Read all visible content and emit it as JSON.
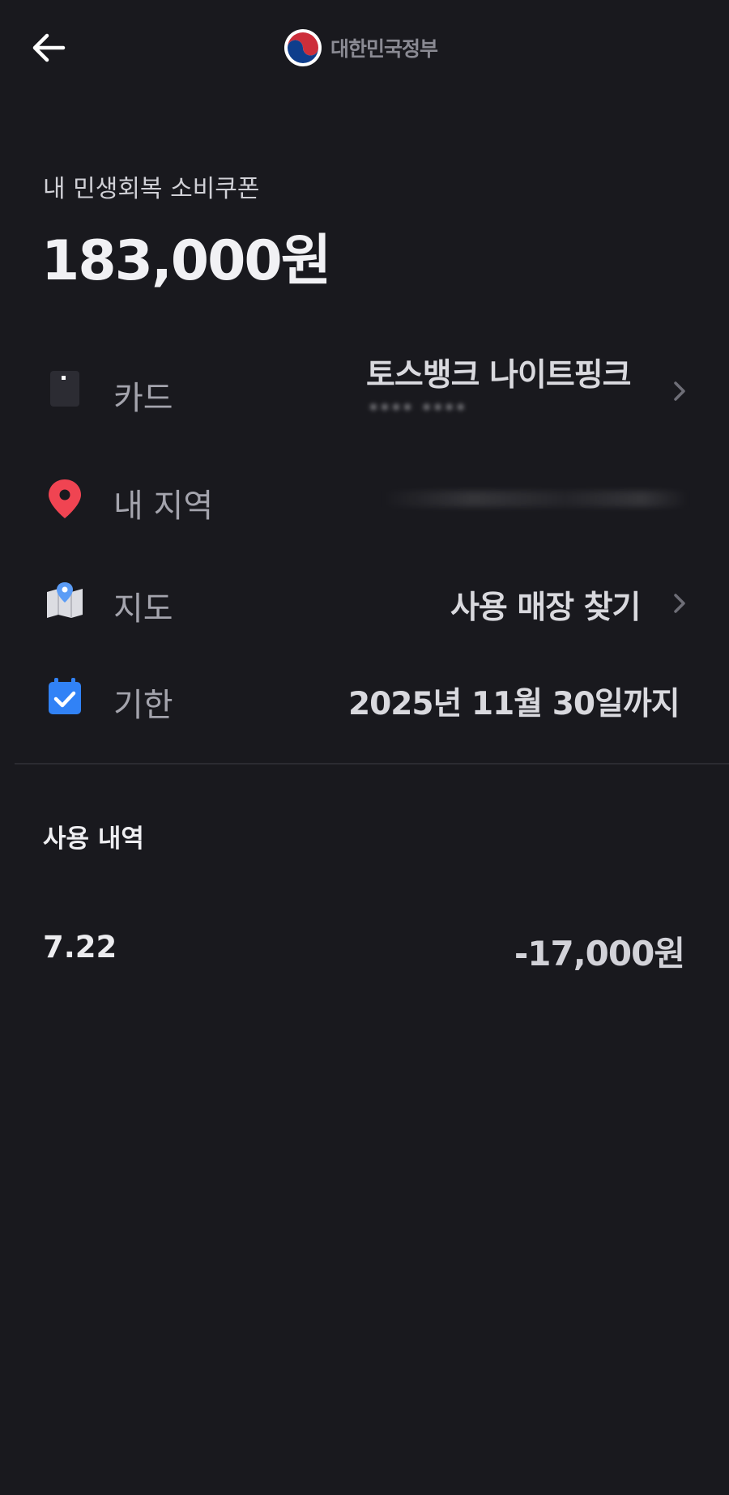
{
  "header": {
    "back_icon": "arrow-left-icon",
    "logo_icon": "taegeuk-emblem-icon",
    "logo_text": "대한민국정부"
  },
  "coupon": {
    "title": "내 민생회복 소비쿠폰",
    "amount": "183,000원"
  },
  "rows": {
    "card": {
      "icon": "card-icon",
      "label": "카드",
      "value": "토스뱅크 나이트핑크",
      "masked_detail": "**** ****"
    },
    "region": {
      "icon": "location-pin-icon",
      "label": "내 지역"
    },
    "map": {
      "icon": "map-icon",
      "label": "지도",
      "value": "사용 매장 찾기"
    },
    "deadline": {
      "icon": "calendar-check-icon",
      "label": "기한",
      "value": "2025년 11월 30일까지"
    }
  },
  "history": {
    "title": "사용 내역",
    "items": [
      {
        "date": "7.22",
        "merchant": "",
        "amount": "-17,000원"
      }
    ]
  },
  "colors": {
    "background": "#19191e",
    "pin_red": "#f04452",
    "calendar_blue": "#3182f6",
    "map_blue": "#5b9cf6"
  }
}
